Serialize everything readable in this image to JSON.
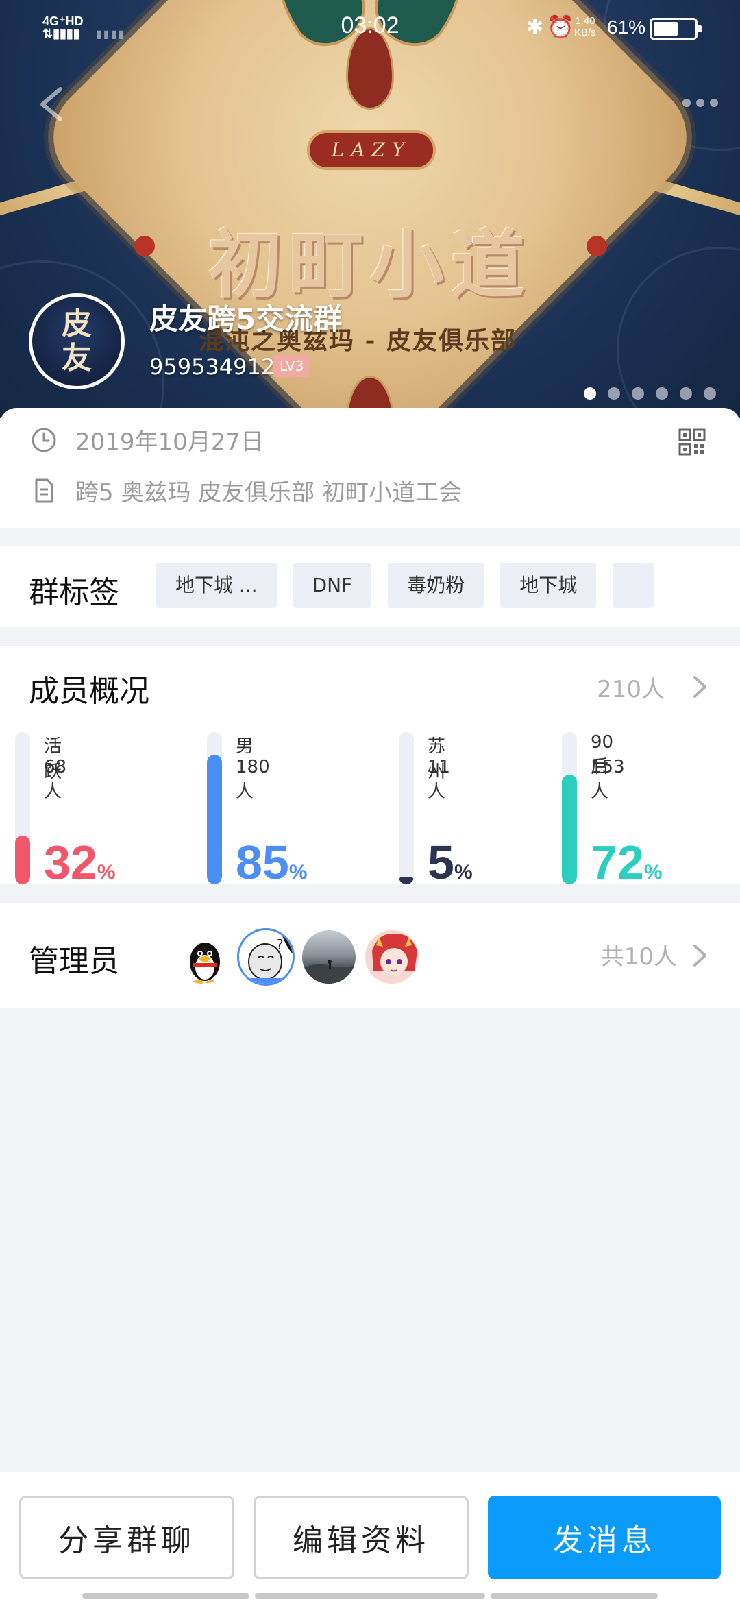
{
  "status_bar": {
    "network": "4G⁺HD",
    "time": "03:02",
    "speed_value": "1.40",
    "speed_unit": "KB/s",
    "battery_pct": "61%",
    "battery_level": 0.61
  },
  "header": {
    "banner_badge": "LAZY",
    "banner_title": "初町小道",
    "banner_subtitle": "混沌之奥兹玛 - 皮友俱乐部",
    "avatar_text_1": "皮",
    "avatar_text_2": "友",
    "group_name": "皮友跨5交流群",
    "group_id": "959534912",
    "level": "LV3",
    "pager_count": 6,
    "pager_active": 0
  },
  "info": {
    "created_date": "2019年10月27日",
    "description": "跨5 奥兹玛 皮友俱乐部 初町小道工会"
  },
  "tags": {
    "title": "群标签",
    "items": [
      "地下城 ...",
      "DNF",
      "毒奶粉",
      "地下城",
      ""
    ]
  },
  "members": {
    "title": "成员概况",
    "total": "210人",
    "stats": [
      {
        "label": "活跃",
        "count": "68人",
        "percent": "32",
        "unit": "%",
        "color": "#f2566a",
        "fraction": 0.32
      },
      {
        "label": "男",
        "count": "180人",
        "percent": "85",
        "unit": "%",
        "color": "#4d8ef5",
        "fraction": 0.85
      },
      {
        "label": "苏州",
        "count": "11人",
        "percent": "5",
        "unit": "%",
        "color": "#2d3450",
        "fraction": 0.05
      },
      {
        "label": "90后",
        "count": "153人",
        "percent": "72",
        "unit": "%",
        "color": "#2bcfc0",
        "fraction": 0.72
      }
    ]
  },
  "admins": {
    "title": "管理员",
    "total": "共10人",
    "avatars": [
      "penguin-avatar",
      "meme-face-avatar",
      "landscape-avatar",
      "anime-girl-avatar"
    ]
  },
  "actions": {
    "share": "分享群聊",
    "edit": "编辑资料",
    "send": "发消息"
  },
  "colors": {
    "primary": "#0a9bfa",
    "background": "#f2f3f7"
  }
}
